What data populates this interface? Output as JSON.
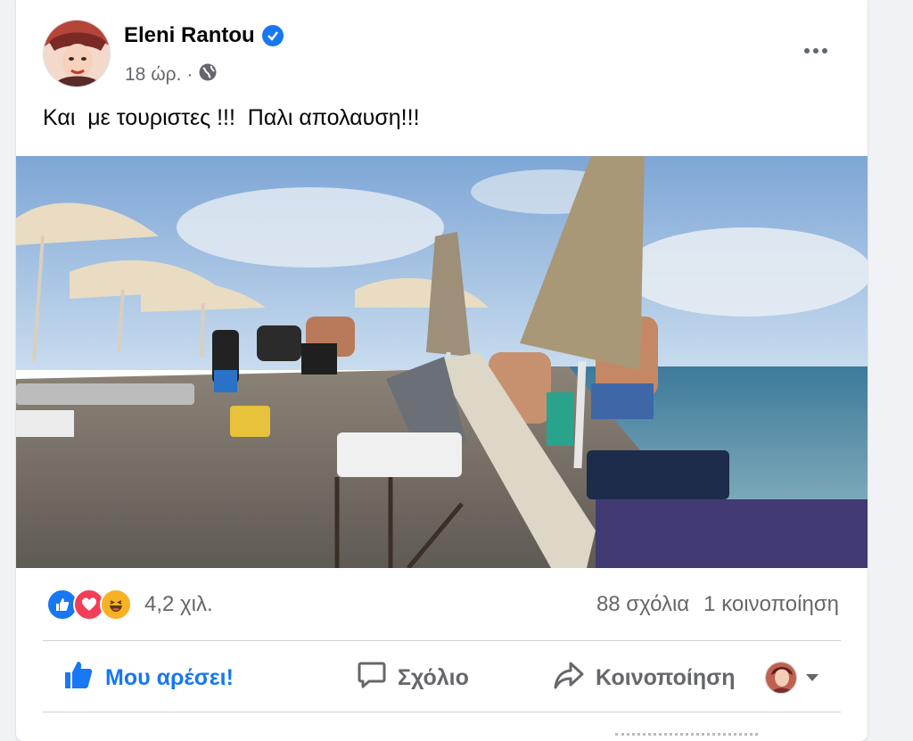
{
  "post": {
    "author": "Eleni Rantou",
    "time": "18 ώρ.",
    "separator": "·",
    "text": "Και  με τουριστες !!!  Παλι απολαυση!!!"
  },
  "stats": {
    "reactions_count": "4,2 χιλ.",
    "comments": "88 σχόλια",
    "shares": "1 κοινοποίηση",
    "reaction_icons": [
      "like-icon",
      "love-icon",
      "haha-icon"
    ]
  },
  "actions": {
    "like": "Μου αρέσει!",
    "comment": "Σχόλιο",
    "share": "Κοινοποίηση"
  },
  "colors": {
    "accent": "#1877f2",
    "love": "#f33e58",
    "haha": "#f7b125",
    "secondary_text": "#65676b"
  }
}
